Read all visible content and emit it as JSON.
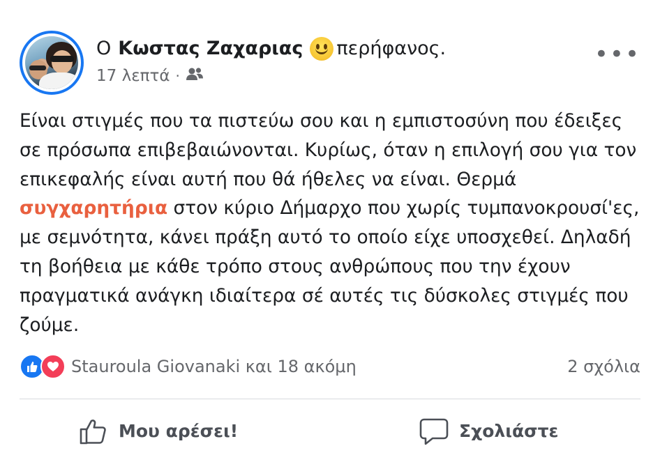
{
  "post": {
    "author_prefix": "Ο",
    "author_name": "Κωστας Ζαχαριας",
    "feeling": "περήφανος.",
    "time": "17 λεπτά",
    "meta_dot": "·",
    "more": "•••",
    "text_part1": "Είναι στιγμές που τα πιστεύω σου και η εμπιστοσύνη που έδειξες σε πρόσωπα επιβεβαιώνονται. Κυρίως, όταν η επιλογή σου για τον  επικεφαλής είναι αυτή που θά ήθελες να είναι. Θερμά ",
    "highlight": "συγχαρητήρια",
    "text_part2": " στον κύριο Δήμαρχο που χωρίς τυμπανοκρουσί'ες, με σεμνότητα, κάνει πράξη αυτό το οποίο είχε υποσχεθεί. Δηλαδή τη βοήθεια με κάθε τρόπο στους ανθρώπους που την έχουν πραγματικά ανάγκη ιδιαίτερα σέ αυτές τις δύσκολες στιγμές που ζούμε.",
    "highlight_color": "#e9603f"
  },
  "reactions": {
    "summary": "Stauroula Giovanaki και 18 ακόμη",
    "comments": "2 σχόλια",
    "icons": [
      "like-icon",
      "love-icon"
    ]
  },
  "actions": {
    "like_label": "Μου αρέσει!",
    "comment_label": "Σχολιάστε"
  },
  "colors": {
    "accent": "#1877f2",
    "love": "#f33e58",
    "muted": "#65676b"
  }
}
